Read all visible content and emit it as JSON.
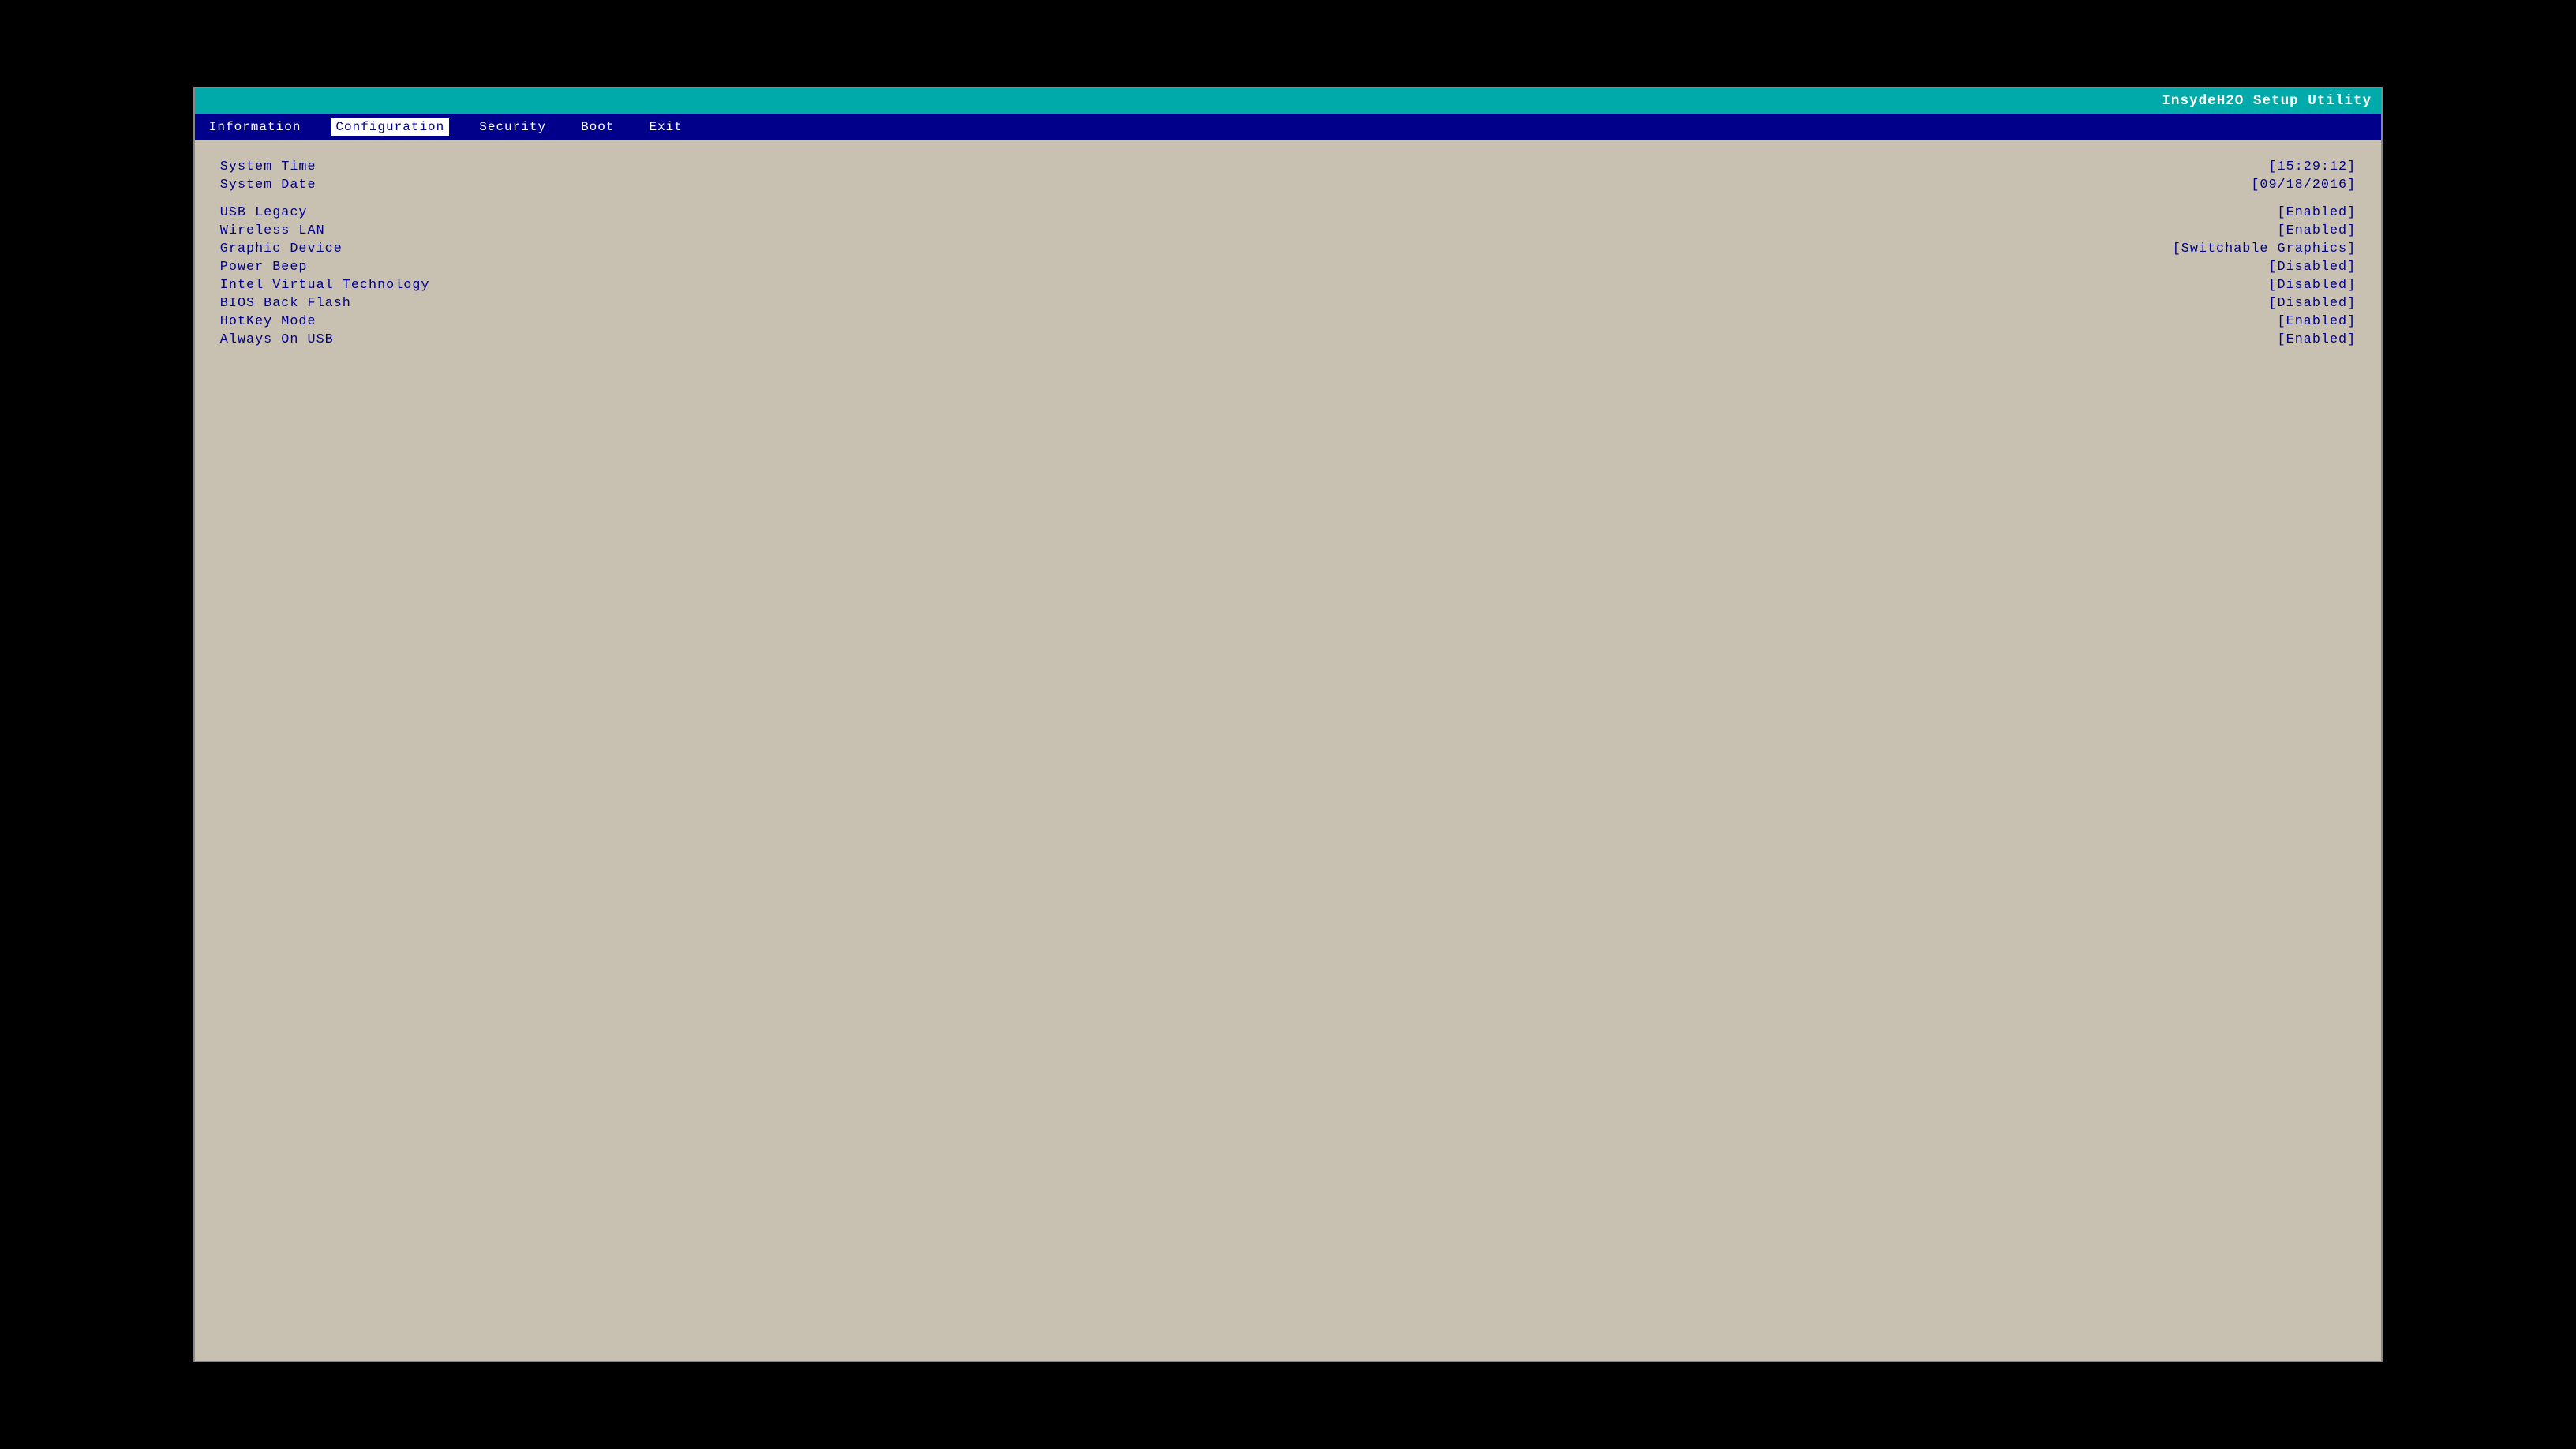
{
  "titleBar": {
    "appName": "InsydeH2O Setup Utility"
  },
  "menuBar": {
    "items": [
      {
        "id": "information",
        "label": "Information",
        "active": false
      },
      {
        "id": "configuration",
        "label": "Configuration",
        "active": true
      },
      {
        "id": "security",
        "label": "Security",
        "active": false
      },
      {
        "id": "boot",
        "label": "Boot",
        "active": false
      },
      {
        "id": "exit",
        "label": "Exit",
        "active": false
      }
    ]
  },
  "settings": [
    {
      "label": "System Time",
      "value": "[15:29:12]",
      "spacer": false
    },
    {
      "label": "System Date",
      "value": "[09/18/2016]",
      "spacer": true
    },
    {
      "label": "USB Legacy",
      "value": "[Enabled]",
      "spacer": false
    },
    {
      "label": "Wireless LAN",
      "value": "[Enabled]",
      "spacer": false
    },
    {
      "label": "Graphic Device",
      "value": "[Switchable Graphics]",
      "spacer": false
    },
    {
      "label": "Power Beep",
      "value": "[Disabled]",
      "spacer": false
    },
    {
      "label": "Intel Virtual Technology",
      "value": "[Disabled]",
      "spacer": false
    },
    {
      "label": "BIOS Back Flash",
      "value": "[Disabled]",
      "spacer": false
    },
    {
      "label": "HotKey Mode",
      "value": "[Enabled]",
      "spacer": false
    },
    {
      "label": "Always On USB",
      "value": "[Enabled]",
      "spacer": false
    }
  ]
}
